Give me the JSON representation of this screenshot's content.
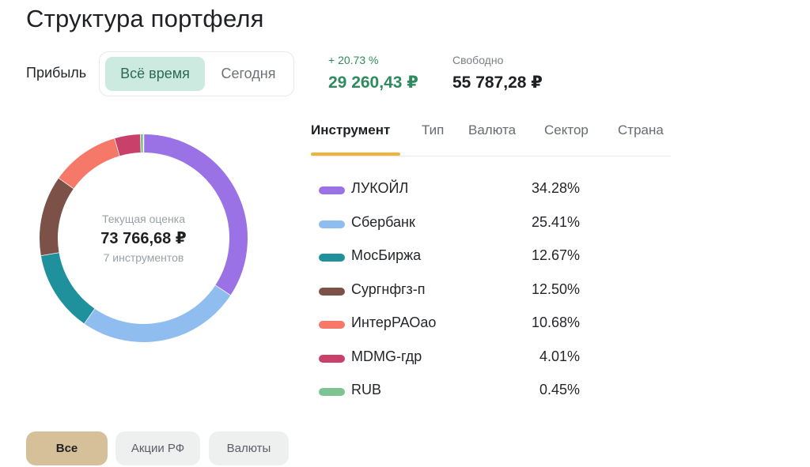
{
  "header": {
    "title": "Структура портфеля"
  },
  "profit": {
    "label": "Прибыль",
    "periods": [
      {
        "label": "Всё время",
        "active": true
      },
      {
        "label": "Сегодня",
        "active": false
      }
    ]
  },
  "stats": {
    "profit_percent": "+ 20.73 %",
    "profit_value": "29 260,43 ₽",
    "free_label": "Свободно",
    "free_value": "55 787,28 ₽"
  },
  "summary": {
    "label": "Текущая оценка",
    "value": "73 766,68 ₽",
    "count": "7 инструментов"
  },
  "tabs": [
    {
      "label": "Инструмент",
      "active": true
    },
    {
      "label": "Тип",
      "active": false
    },
    {
      "label": "Валюта",
      "active": false
    },
    {
      "label": "Сектор",
      "active": false
    },
    {
      "label": "Страна",
      "active": false
    }
  ],
  "holdings": [
    {
      "name": "ЛУКОЙЛ",
      "percent": "34.28%",
      "share": 34.28,
      "color": "#9a72e6"
    },
    {
      "name": "Сбербанк",
      "percent": "25.41%",
      "share": 25.41,
      "color": "#8fbdf0"
    },
    {
      "name": "МосБиржа",
      "percent": "12.67%",
      "share": 12.67,
      "color": "#1f919c"
    },
    {
      "name": "Сургнфгз-п",
      "percent": "12.50%",
      "share": 12.5,
      "color": "#7b5148"
    },
    {
      "name": "ИнтерРАОао",
      "percent": "10.68%",
      "share": 10.68,
      "color": "#f57868"
    },
    {
      "name": "MDMG-гдр",
      "percent": "4.01%",
      "share": 4.01,
      "color": "#c9406a"
    },
    {
      "name": "RUB",
      "percent": "0.45%",
      "share": 0.45,
      "color": "#7cc491"
    }
  ],
  "filters": [
    {
      "label": "Все",
      "active": true
    },
    {
      "label": "Акции РФ",
      "active": false
    },
    {
      "label": "Валюты",
      "active": false
    }
  ]
}
